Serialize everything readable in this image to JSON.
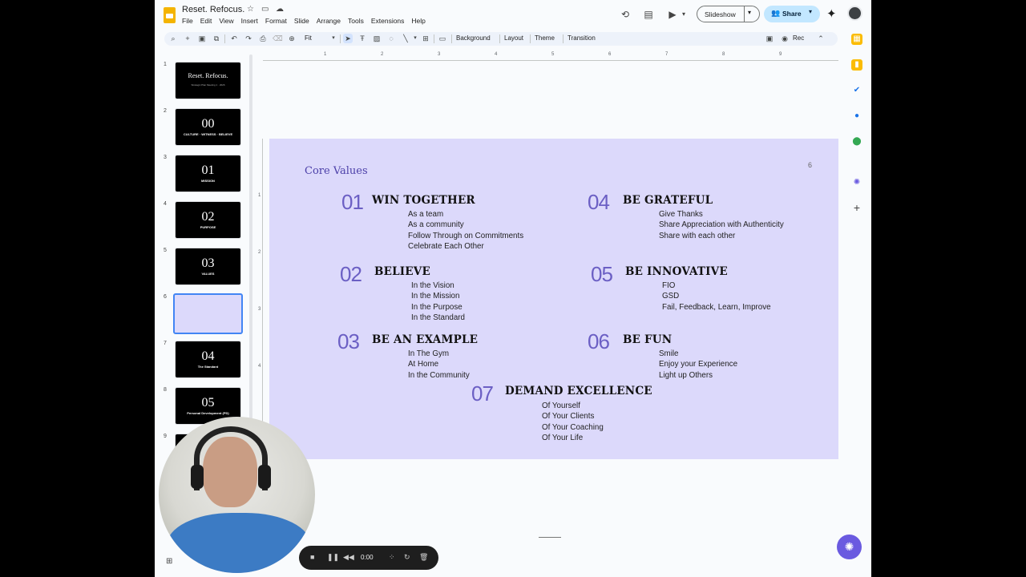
{
  "document": {
    "title": "Reset. Refocus."
  },
  "menu": [
    "File",
    "Edit",
    "View",
    "Insert",
    "Format",
    "Slide",
    "Arrange",
    "Tools",
    "Extensions",
    "Help"
  ],
  "header": {
    "slideshow_label": "Slideshow",
    "share_label": "Share"
  },
  "toolbar": {
    "zoom": "Fit",
    "background": "Background",
    "layout": "Layout",
    "theme": "Theme",
    "transition": "Transition",
    "rec": "Rec"
  },
  "ruler": {
    "h": [
      "1",
      "2",
      "3",
      "4",
      "5",
      "6",
      "7",
      "8",
      "9"
    ],
    "v": [
      "1",
      "2",
      "3",
      "4"
    ]
  },
  "filmstrip": [
    {
      "num": "1",
      "title": "Reset. Refocus.",
      "sub": "Strategic Plan Meeting 1 · 2026"
    },
    {
      "num": "2",
      "big": "00",
      "sub": "CULTURE · WITNESS · BELIEVE"
    },
    {
      "num": "3",
      "big": "01",
      "sub": "MISSION"
    },
    {
      "num": "4",
      "big": "02",
      "sub": "PURPOSE"
    },
    {
      "num": "5",
      "big": "03",
      "sub": "VALUES"
    },
    {
      "num": "6"
    },
    {
      "num": "7",
      "big": "04",
      "sub": "The Standard"
    },
    {
      "num": "8",
      "big": "05",
      "sub": "Personal Development (PD)"
    },
    {
      "num": "9"
    }
  ],
  "slide": {
    "title": "Core Values",
    "page": "6",
    "values": [
      {
        "num": "01",
        "head": "WIN TOGETHER",
        "items": [
          "As a team",
          "As a community",
          "Follow Through on Commitments",
          "Celebrate Each Other"
        ]
      },
      {
        "num": "02",
        "head": "BELIEVE",
        "items": [
          "In the Vision",
          "In the Mission",
          "In the Purpose",
          "In the Standard"
        ]
      },
      {
        "num": "03",
        "head": "BE AN EXAMPLE",
        "items": [
          "In The Gym",
          "At Home",
          "In the Community"
        ]
      },
      {
        "num": "04",
        "head": "BE GRATEFUL",
        "items": [
          "Give Thanks",
          "Share Appreciation with Authenticity",
          "Share with each other"
        ]
      },
      {
        "num": "05",
        "head": "BE INNOVATIVE",
        "items": [
          "FIO",
          "GSD",
          "Fail, Feedback, Learn, Improve"
        ]
      },
      {
        "num": "06",
        "head": "BE FUN",
        "items": [
          "Smile",
          "Enjoy your Experience",
          "Light up Others"
        ]
      },
      {
        "num": "07",
        "head": "DEMAND EXCELLENCE",
        "items": [
          "Of Yourself",
          "Of Your Clients",
          "Of Your Coaching",
          "Of Your Life"
        ]
      }
    ]
  },
  "recorder": {
    "time": "0:00"
  },
  "colors": {
    "slide_bg": "#dcd9fb",
    "accent": "#6b5fc4",
    "share_bg": "#c2e7ff"
  }
}
